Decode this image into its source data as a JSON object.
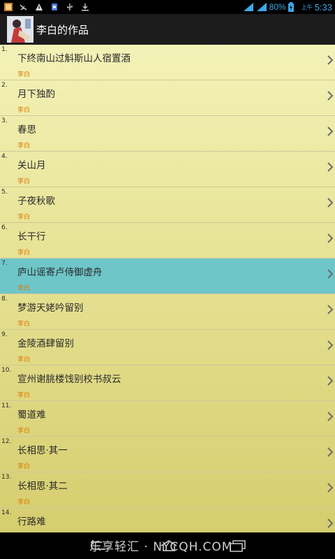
{
  "status_bar": {
    "battery": "80%",
    "ampm": "上午",
    "time": "5:33"
  },
  "app": {
    "title": "李白的作品"
  },
  "poems": [
    {
      "num": "1.",
      "title": "下终南山过斛斯山人宿置酒",
      "author": "李白"
    },
    {
      "num": "2.",
      "title": "月下独酌",
      "author": "李白"
    },
    {
      "num": "3.",
      "title": "春思",
      "author": "李白"
    },
    {
      "num": "4.",
      "title": "关山月",
      "author": "李白"
    },
    {
      "num": "5.",
      "title": "子夜秋歌",
      "author": "李白"
    },
    {
      "num": "6.",
      "title": "长干行",
      "author": "李白"
    },
    {
      "num": "7.",
      "title": "庐山谣寄卢侍御虚舟",
      "author": "李白"
    },
    {
      "num": "8.",
      "title": "梦游天姥吟留别",
      "author": "李白"
    },
    {
      "num": "9.",
      "title": "金陵酒肆留别",
      "author": "李白"
    },
    {
      "num": "10.",
      "title": "宣州谢朓楼饯别校书叔云",
      "author": "李白"
    },
    {
      "num": "11.",
      "title": "蜀道难",
      "author": "李白"
    },
    {
      "num": "12.",
      "title": "长相思·其一",
      "author": "李白"
    },
    {
      "num": "13.",
      "title": "长相思·其二",
      "author": "李白"
    },
    {
      "num": "14.",
      "title": "行路难",
      "author": ""
    }
  ],
  "selected_index": 6,
  "watermark": "乐享轻汇 · NYCQH.COM",
  "colors": {
    "selected_row": "#6ec6c9",
    "author_text": "#e07800",
    "status_icons": "#3fa8e5"
  }
}
